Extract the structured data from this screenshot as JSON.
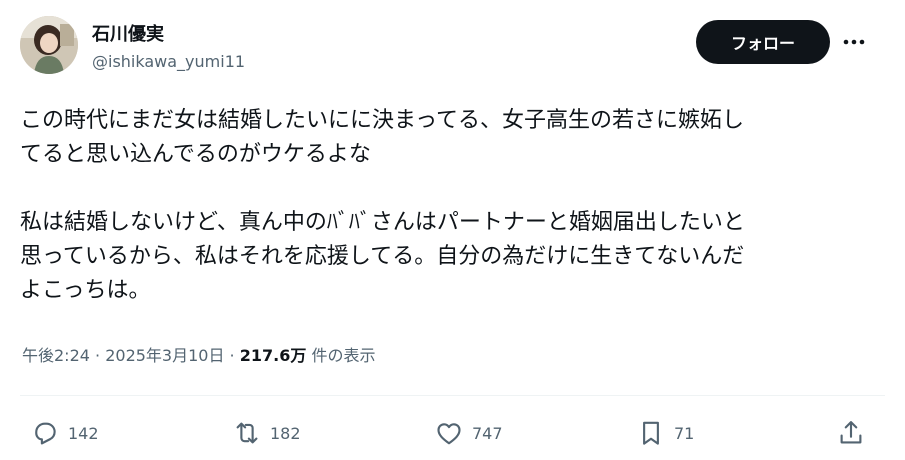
{
  "user": {
    "name": "石川優実",
    "handle": "@ishikawa_yumi11"
  },
  "follow_label": "フォロー",
  "tweet": {
    "text": "この時代にまだ女は結婚したいにに決まってる、女子高生の若さに嫉妬し\nてると思い込んでるのがウケるよな\n\n私は結婚しないけど、真ん中のﾊﾞﾊﾞさんはパートナーと婚姻届出したいと\n思っているから、私はそれを応援してる。自分の為だけに生きてないんだ\nよこっちは。"
  },
  "meta": {
    "time": "午後2:24",
    "sep1": " · ",
    "date": "2025年3月10日",
    "sep2": " · ",
    "views": "217.6万",
    "views_label": " 件の表示"
  },
  "actions": {
    "reply_count": "142",
    "retweet_count": "182",
    "like_count": "747",
    "bookmark_count": "71"
  },
  "icons": [
    "more-icon",
    "reply-icon",
    "retweet-icon",
    "like-icon",
    "bookmark-icon",
    "share-icon"
  ],
  "colors": {
    "text": "#0f1419",
    "muted": "#536471",
    "button": "#0f1419"
  }
}
